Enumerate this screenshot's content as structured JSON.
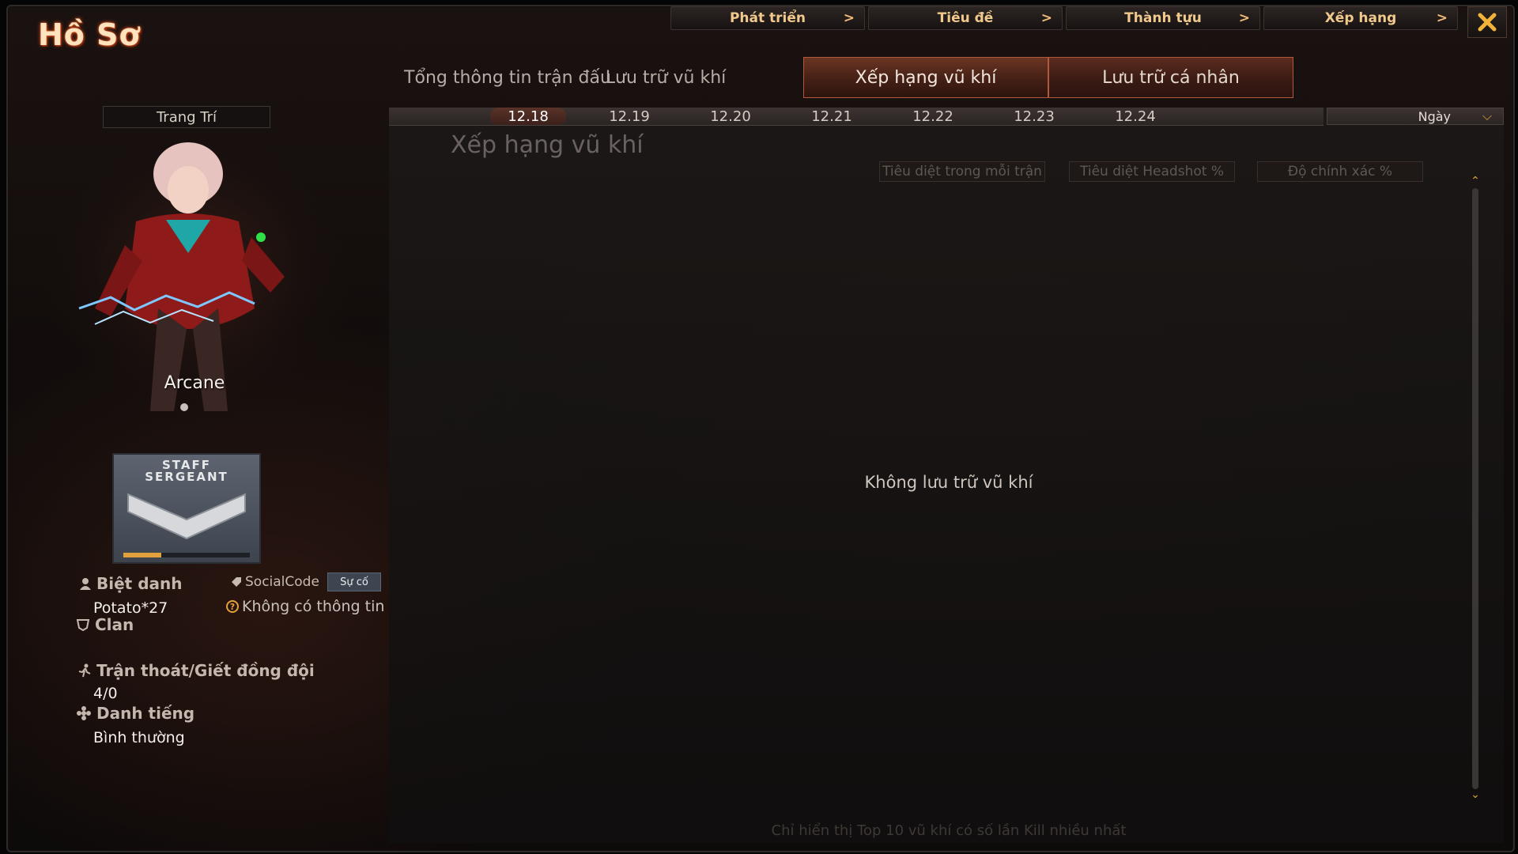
{
  "window": {
    "title": "Hồ Sơ"
  },
  "top_nav": [
    {
      "label": "Phát triển",
      "arrow": ">"
    },
    {
      "label": "Tiêu đề",
      "arrow": ">"
    },
    {
      "label": "Thành tựu",
      "arrow": ">"
    },
    {
      "label": "Xếp hạng",
      "arrow": ">"
    }
  ],
  "tabs": [
    {
      "label": "Tổng thông tin trận đấu",
      "state": "normal"
    },
    {
      "label": "Lưu trữ vũ khí",
      "state": "normal"
    },
    {
      "label": "Xếp hạng vũ khí",
      "state": "active"
    },
    {
      "label": "Lưu trữ cá nhân",
      "state": "normal"
    }
  ],
  "profile": {
    "decor_button": "Trang Trí",
    "character_name": "Arcane",
    "rank": {
      "line1": "STAFF",
      "line2": "SERGEANT",
      "progress": 0.3
    },
    "nickname_label": "Biệt danh",
    "nickname": "Potato*27",
    "clan_label": "Clan",
    "social_label": "SocialCode",
    "report_button": "Sự cố",
    "social_value": "Không có thông tin",
    "escape_label": "Trận thoát/Giết đồng đội",
    "escape_value": "4/0",
    "reputation_label": "Danh tiếng",
    "reputation_value": "Bình thường"
  },
  "ranking": {
    "dates": [
      "12.18",
      "12.19",
      "12.20",
      "12.21",
      "12.22",
      "12.23",
      "12.24"
    ],
    "selected_date": "12.18",
    "period": "Ngày",
    "title": "Xếp hạng vũ khí",
    "sort_buttons": [
      "Tiêu diệt trong mỗi trận",
      "Tiêu diệt Headshot %",
      "Độ chính xác %"
    ],
    "empty_message": "Không lưu trữ vũ khí",
    "footer_note": "Chỉ hiển thị Top 10 vũ khí có số lần Kill nhiều nhất"
  },
  "colors": {
    "accent": "#e2a13c",
    "tab_border": "#b1593c",
    "title_glow": "#c2421a"
  },
  "icons": {
    "close": "close-icon",
    "nickname": "person-icon",
    "clan": "clan-icon",
    "social": "tag-icon",
    "help": "question-icon",
    "escape": "runner-icon",
    "reputation": "flower-icon"
  }
}
